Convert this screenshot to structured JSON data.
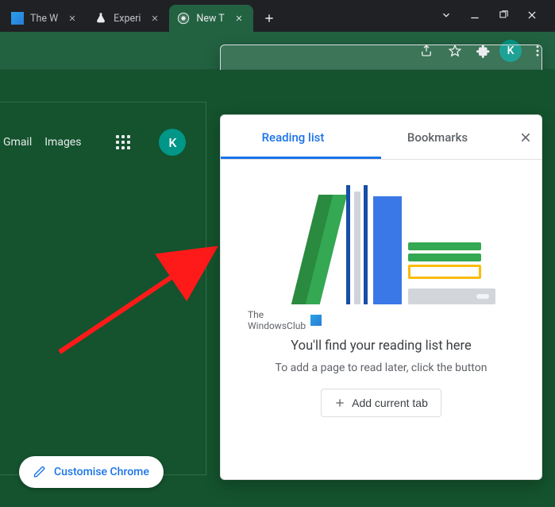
{
  "tabs": [
    {
      "label": "The W"
    },
    {
      "label": "Experi"
    },
    {
      "label": "New T"
    }
  ],
  "toolbar": {
    "avatarLetter": "K"
  },
  "ntp": {
    "gmail": "Gmail",
    "images": "Images",
    "avatarLetter": "K",
    "customise": "Customise Chrome"
  },
  "sidepanel": {
    "tabs": {
      "reading": "Reading list",
      "bookmarks": "Bookmarks"
    },
    "watermark": {
      "line1": "The",
      "line2": "WindowsClub"
    },
    "headline": "You'll find your reading list here",
    "subline": "To add a page to read later, click the button",
    "addBtn": "Add current tab"
  }
}
